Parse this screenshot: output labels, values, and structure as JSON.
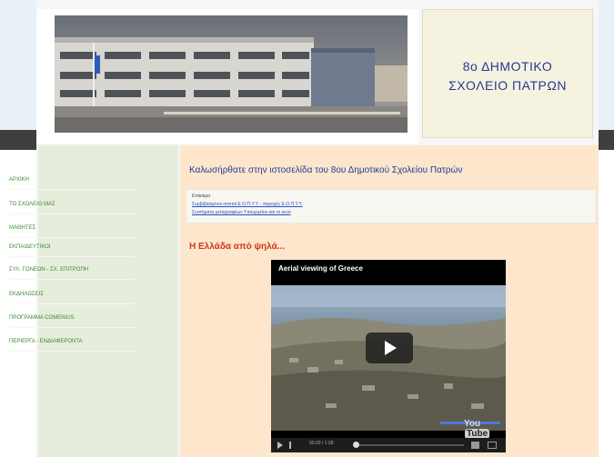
{
  "header": {
    "school_name_line1": "8ο ΔΗΜΟΤΙΚΟ",
    "school_name_line2": "ΣΧΟΛΕΙΟ ΠΑΤΡΩΝ"
  },
  "sidebar": {
    "items": [
      {
        "label": "ΑΡΧΙΚΗ"
      },
      {
        "label": "ΤΟ ΣΧΟΛΕΙΟ ΜΑΣ"
      },
      {
        "label": "ΜΑΘΗΤΕΣ"
      },
      {
        "label": "ΕΚΠΑΙΔΕΥΤΙΚΟΙ"
      },
      {
        "label": "ΣΥΛ. ΓΟΝΕΩΝ - ΣΧ. ΕΠΙΤΡΟΠΗ"
      },
      {
        "label": "ΕΚΔΗΛΩΣΕΙΣ"
      },
      {
        "label": "ΠΡΟΓΡΑΜΜΑ COMENIUS"
      },
      {
        "label": "ΠΕΡΙΕΡΓΑ - ΕΝΔΙΑΦΕΡΟΝΤΑ"
      }
    ]
  },
  "main": {
    "welcome": "Καλωσήρθατε στην ιστοσελίδα του 8ου Δημοτικού Σχολείου Πατρών",
    "links_label": "Επίκαιρα",
    "links": [
      "Συμβιβασμένοι ιστοτοί Ε.Ο.Π.Υ.Υ. - παροχές Ε.Ο.Π.Υ.Υ.",
      "Συστήματα μεταγραφέων Υπουργείου και το κενό"
    ],
    "section_title": "Η Ελλάδα από ψηλά...",
    "video": {
      "title": "Aerial viewing of Greece",
      "logo_you": "You",
      "logo_tube": "Tube",
      "time": "00:00 / 1:28"
    }
  },
  "colors": {
    "title_blue": "#233a93",
    "nav_green": "#3d8a35",
    "section_red": "#cc3a1a",
    "main_bg": "#fde6cc",
    "sidebar_bg": "#e6eddc"
  }
}
